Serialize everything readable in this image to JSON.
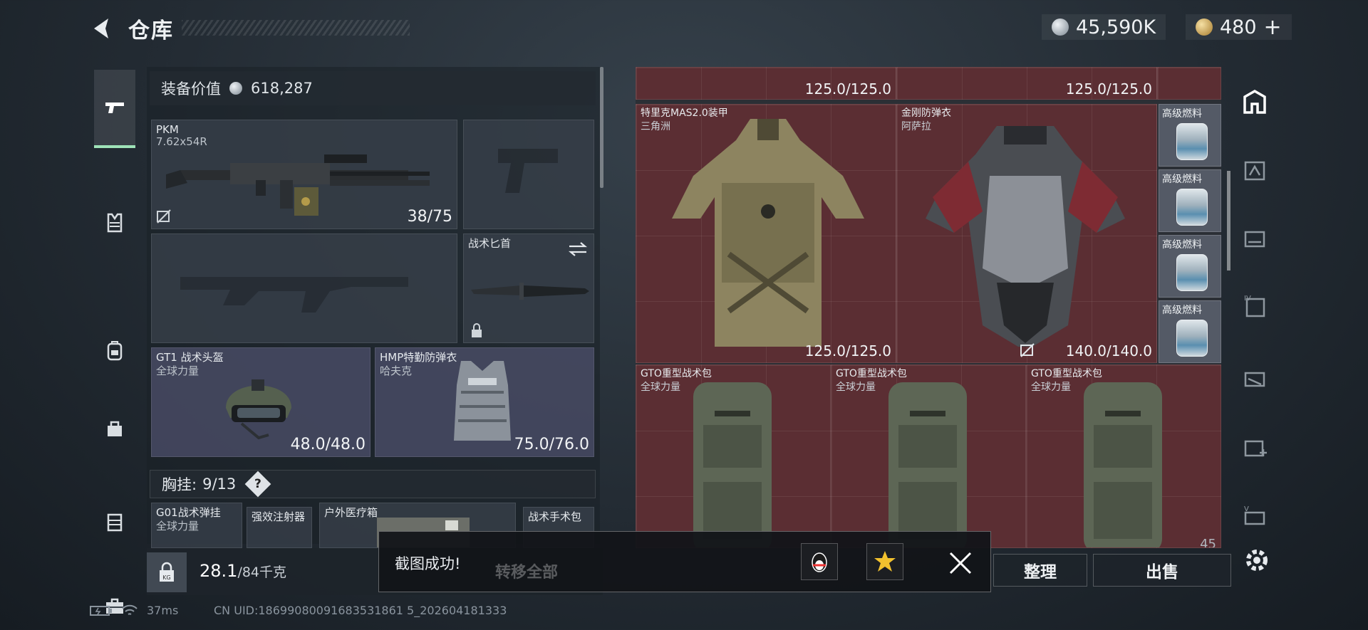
{
  "header": {
    "title": "仓库",
    "silver_amount": "45,590K",
    "gold_amount": "480",
    "gold_add": "+"
  },
  "loadout": {
    "value_label": "装备价值",
    "value": "618,287",
    "primary": {
      "name": "PKM",
      "caliber": "7.62x54R",
      "ammo": "38/75"
    },
    "knife": {
      "name": "战术匕首"
    },
    "helmet": {
      "name": "GT1 战术头盔",
      "brand": "全球力量",
      "durability": "48.0/48.0"
    },
    "armor": {
      "name": "HMP特勤防弹衣",
      "brand": "哈夫克",
      "durability": "75.0/76.0"
    },
    "rig": {
      "label": "胸挂:",
      "count": "9/13",
      "help": "?"
    },
    "rig_items": [
      {
        "name": "G01战术弹挂",
        "brand": "全球力量"
      },
      {
        "name": "强效注射器"
      },
      {
        "name": "户外医疗箱"
      },
      {
        "name": "战术手术包"
      }
    ],
    "weight": "28.1",
    "weight_max": "/84千克"
  },
  "storage": {
    "top_durability_left": "125.0/125.0",
    "top_durability_right": "125.0/125.0",
    "armor1": {
      "name": "特里克MAS2.0装甲",
      "brand": "三角洲",
      "durability": "125.0/125.0"
    },
    "armor2": {
      "name": "金刚防弹衣",
      "brand": "阿萨拉",
      "durability": "140.0/140.0"
    },
    "fuel_items": [
      "高级燃料",
      "高级燃料",
      "高级燃料",
      "高级燃料"
    ],
    "bags": [
      {
        "name": "GTO重型战术包",
        "brand": "全球力量"
      },
      {
        "name": "GTO重型战术包",
        "brand": "全球力量"
      },
      {
        "name": "GTO重型战术包",
        "brand": "全球力量"
      }
    ],
    "bag_count_partial": "45"
  },
  "actions": {
    "transfer_all": "转移全部",
    "sort": "整理",
    "sell": "出售"
  },
  "toast": {
    "message": "截图成功!"
  },
  "status": {
    "ping": "37ms",
    "uid": "CN UID:18699080091683531861 5_202604181333"
  },
  "colors": {
    "grid_red": "#5b2e33",
    "accent_green": "#9fe3b8",
    "panel_dark": "#1a2026"
  }
}
